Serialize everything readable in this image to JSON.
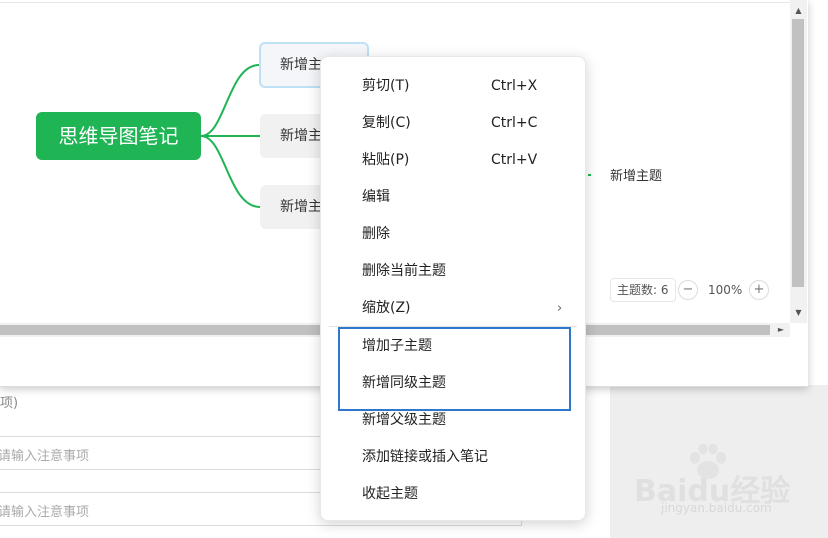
{
  "mindmap": {
    "central_topic": "思维导图笔记",
    "branches": [
      "新增主",
      "新增主",
      "新增主"
    ],
    "sub_topic": "新增主题",
    "colors": {
      "central": "#1fb454",
      "link": "#1fb454",
      "selected_border": "#bfe0f5"
    }
  },
  "toolbar": {
    "topic_count": "主题数: 6",
    "zoom_minus": "−",
    "zoom_level": "100%",
    "zoom_plus": "+"
  },
  "scrollbars": {
    "up": "▲",
    "down": "▼",
    "right": "►"
  },
  "form": {
    "row_top_text": "项)",
    "placeholder_1": "请输入注意事项",
    "placeholder_2": "请输入注意事项"
  },
  "context_menu": {
    "items": [
      {
        "label": "剪切(T)",
        "shortcut": "Ctrl+X"
      },
      {
        "label": "复制(C)",
        "shortcut": "Ctrl+C"
      },
      {
        "label": "粘贴(P)",
        "shortcut": "Ctrl+V"
      },
      {
        "label": "编辑"
      },
      {
        "label": "删除"
      },
      {
        "label": "删除当前主题"
      },
      {
        "label": "缩放(Z)",
        "submenu_icon": "chevron-right-icon"
      },
      {
        "label": "增加子主题"
      },
      {
        "label": "新增同级主题"
      },
      {
        "label": "新增父级主题"
      },
      {
        "label": "添加链接或插入笔记"
      },
      {
        "label": "收起主题"
      }
    ],
    "submenu_arrow": "›",
    "highlight_color": "#2f76cf"
  },
  "watermark": {
    "logo_text": "Baidu经验",
    "sub_text": "jingyan.baidu.com"
  }
}
